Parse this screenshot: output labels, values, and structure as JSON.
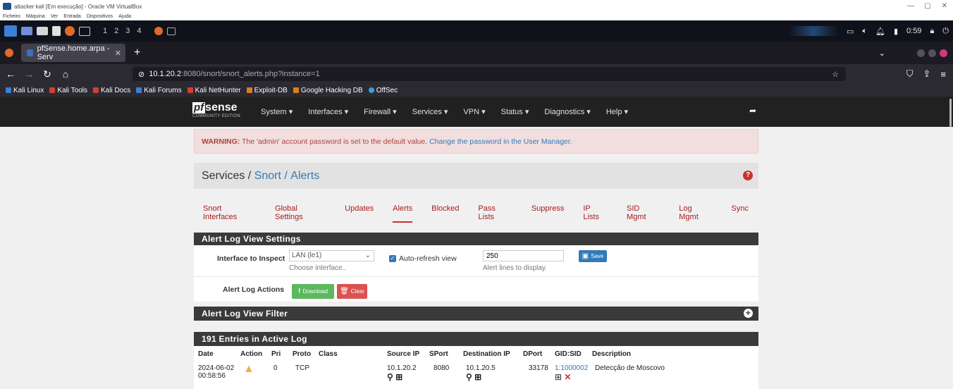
{
  "vbox": {
    "title": "attacker kali [Em execução] - Oracle VM VirtualBox",
    "menu": [
      "Ficheiro",
      "Máquina",
      "Ver",
      "Entrada",
      "Dispositivos",
      "Ajuda"
    ],
    "controls": [
      "—",
      "▢",
      "✕"
    ]
  },
  "kali_panel": {
    "workspaces": [
      "1",
      "2",
      "3",
      "4"
    ],
    "clock": "0:59"
  },
  "browser": {
    "tab_title": "pfSense.home.arpa - Serv",
    "url_host": "10.1.20.2",
    "url_rest": ":8080/snort/snort_alerts.php?instance=1",
    "bookmarks": [
      "Kali Linux",
      "Kali Tools",
      "Kali Docs",
      "Kali Forums",
      "Kali NetHunter",
      "Exploit-DB",
      "Google Hacking DB",
      "OffSec"
    ]
  },
  "pfsense": {
    "logo_word": "sense",
    "logo_box": "pf",
    "edition": "COMMUNITY EDITION",
    "menu": [
      "System ▾",
      "Interfaces ▾",
      "Firewall ▾",
      "Services ▾",
      "VPN ▾",
      "Status ▾",
      "Diagnostics ▾",
      "Help ▾"
    ]
  },
  "warning": {
    "label": "WARNING:",
    "text": " The 'admin' account password is set to the default value. ",
    "link": "Change the password in the User Manager."
  },
  "breadcrumb": {
    "root": "Services / ",
    "mid": "Snort / ",
    "leaf": "Alerts"
  },
  "tabs": [
    "Snort Interfaces",
    "Global Settings",
    "Updates",
    "Alerts",
    "Blocked",
    "Pass Lists",
    "Suppress",
    "IP Lists",
    "SID Mgmt",
    "Log Mgmt",
    "Sync"
  ],
  "settings": {
    "header": "Alert Log View Settings",
    "interface_label": "Interface to Inspect",
    "interface_value": "LAN (le1)",
    "interface_help": "Choose interface..",
    "autorefresh_label": "Auto-refresh view",
    "lines_value": "250",
    "lines_help": "Alert lines to display.",
    "save": "Save",
    "actions_label": "Alert Log Actions",
    "download": "Download",
    "clear": "Clear"
  },
  "filter": {
    "header": "Alert Log View Filter"
  },
  "log": {
    "header": "191 Entries in Active Log",
    "columns": [
      "Date",
      "Action",
      "Pri",
      "Proto",
      "Class",
      "Source IP",
      "SPort",
      "Destination IP",
      "DPort",
      "GID:SID",
      "Description"
    ],
    "rows": [
      {
        "date": "2024-06-02",
        "time": "00:58:56",
        "pri": "0",
        "proto": "TCP",
        "class": "",
        "src": "10.1.20.2",
        "sport": "8080",
        "dst": "10.1.20.5",
        "dport": "33178",
        "gidsid": "1:1000002",
        "desc": "Detecção de Moscovo"
      }
    ]
  }
}
